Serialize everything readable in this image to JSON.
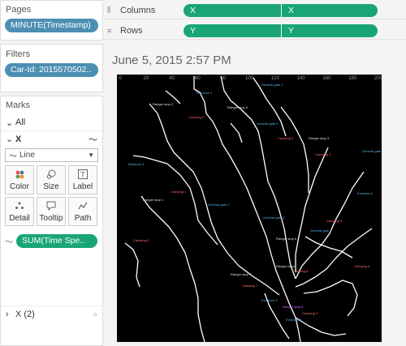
{
  "pages": {
    "title": "Pages",
    "pill": "MINUTE(Timestamp)"
  },
  "filters": {
    "title": "Filters",
    "pill": "Car-Id: 2015570502.."
  },
  "marks": {
    "title": "Marks",
    "all_label": "All",
    "x_label": "X",
    "mark_type": "Line",
    "buttons": [
      {
        "label": "Color",
        "icon": "color-icon"
      },
      {
        "label": "Size",
        "icon": "size-icon"
      },
      {
        "label": "Label",
        "icon": "label-icon"
      },
      {
        "label": "Detail",
        "icon": "detail-icon"
      },
      {
        "label": "Tooltip",
        "icon": "tooltip-icon"
      },
      {
        "label": "Path",
        "icon": "path-icon"
      }
    ],
    "size_pill": "SUM(Time Spe..",
    "x2_label": "X (2)"
  },
  "columns": {
    "label": "Columns",
    "pills": [
      "X",
      "X"
    ]
  },
  "rows": {
    "label": "Rows",
    "pills": [
      "Y",
      "Y"
    ]
  },
  "view": {
    "title": "June 5, 2015 2:57 PM",
    "tick_labels": [
      "0",
      "20",
      "40",
      "60",
      "80",
      "100",
      "120",
      "140",
      "160",
      "180",
      "200"
    ]
  },
  "colors": {
    "pill_blue": "#4d8fb3",
    "pill_green": "#19a577",
    "map_bg": "#000000",
    "road": "#ffffff"
  }
}
